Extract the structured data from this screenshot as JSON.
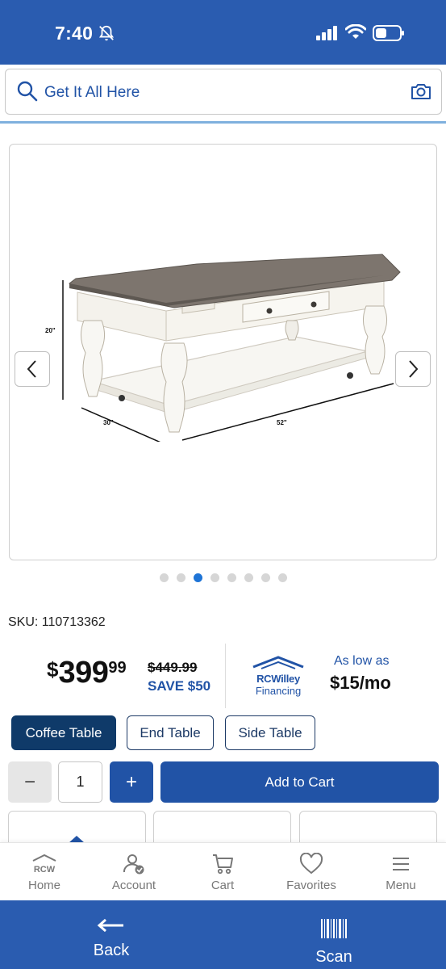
{
  "status_bar": {
    "time": "7:40"
  },
  "search": {
    "placeholder": "Get It All Here"
  },
  "gallery": {
    "dimension_labels": {
      "height": "20\"",
      "depth": "30\"",
      "width": "52\""
    },
    "dot_count": 8,
    "active_dot": 3
  },
  "product": {
    "sku": "SKU: 110713362",
    "price_dollar": "$",
    "price_whole": "399",
    "price_cents": "99",
    "was_price": "$449.99",
    "save_text": "SAVE $50"
  },
  "financing": {
    "brand": "RCWilley",
    "sub": "Financing",
    "as_low_as": "As low as",
    "monthly": "$15/mo"
  },
  "variants": [
    {
      "label": "Coffee Table",
      "selected": true
    },
    {
      "label": "End Table",
      "selected": false
    },
    {
      "label": "Side Table",
      "selected": false
    }
  ],
  "cart": {
    "minus": "−",
    "quantity": "1",
    "plus": "+",
    "add_label": "Add to Cart"
  },
  "tabbar": {
    "home": "Home",
    "home_logo": "RCW",
    "account": "Account",
    "cart": "Cart",
    "favorites": "Favorites",
    "menu": "Menu"
  },
  "bottom_bar": {
    "back": "Back",
    "scan": "Scan"
  },
  "colors": {
    "brand_blue": "#2a5cb0",
    "accent": "#2153a6",
    "selected_chip": "#0f3a69",
    "active_dot": "#1e74d6"
  }
}
